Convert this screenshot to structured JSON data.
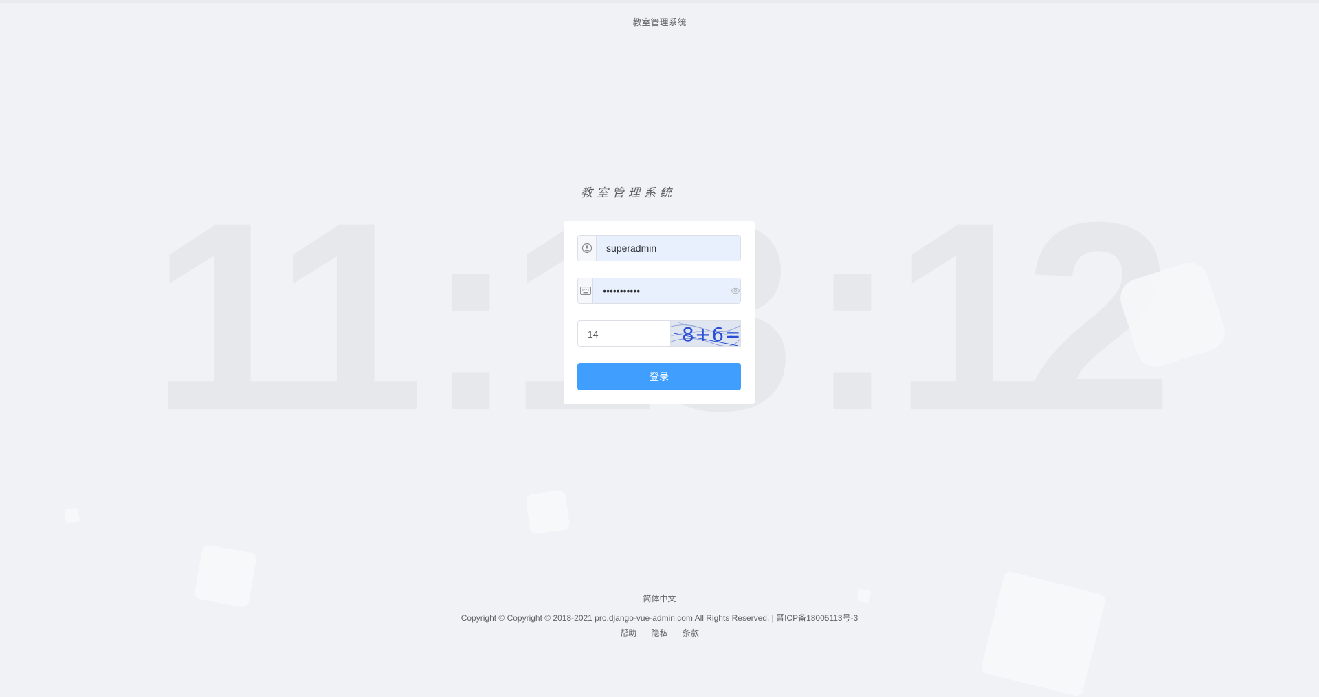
{
  "header": {
    "title": "教室管理系统"
  },
  "clock": {
    "time_digits": [
      "1",
      "1",
      ":",
      "1",
      "3",
      ":",
      "1",
      "2"
    ]
  },
  "login": {
    "logo_text": "教室管理系统",
    "username": {
      "icon": "user-circle-icon",
      "value": "superadmin"
    },
    "password": {
      "icon": "keyboard-icon",
      "value": "•••••••••••",
      "suffix_icon": "eye-icon"
    },
    "captcha": {
      "value": "14",
      "image_text": "8+6="
    },
    "submit_label": "登录"
  },
  "footer": {
    "language": "简体中文",
    "copyright": "Copyright © Copyright © 2018-2021 pro.django-vue-admin.com All Rights Reserved. | 晋ICP备18005113号-3",
    "links": [
      "帮助",
      "隐私",
      "条款"
    ]
  },
  "colors": {
    "primary": "#409eff",
    "background": "#f0f2f5",
    "autofill": "#e8f0fe"
  }
}
